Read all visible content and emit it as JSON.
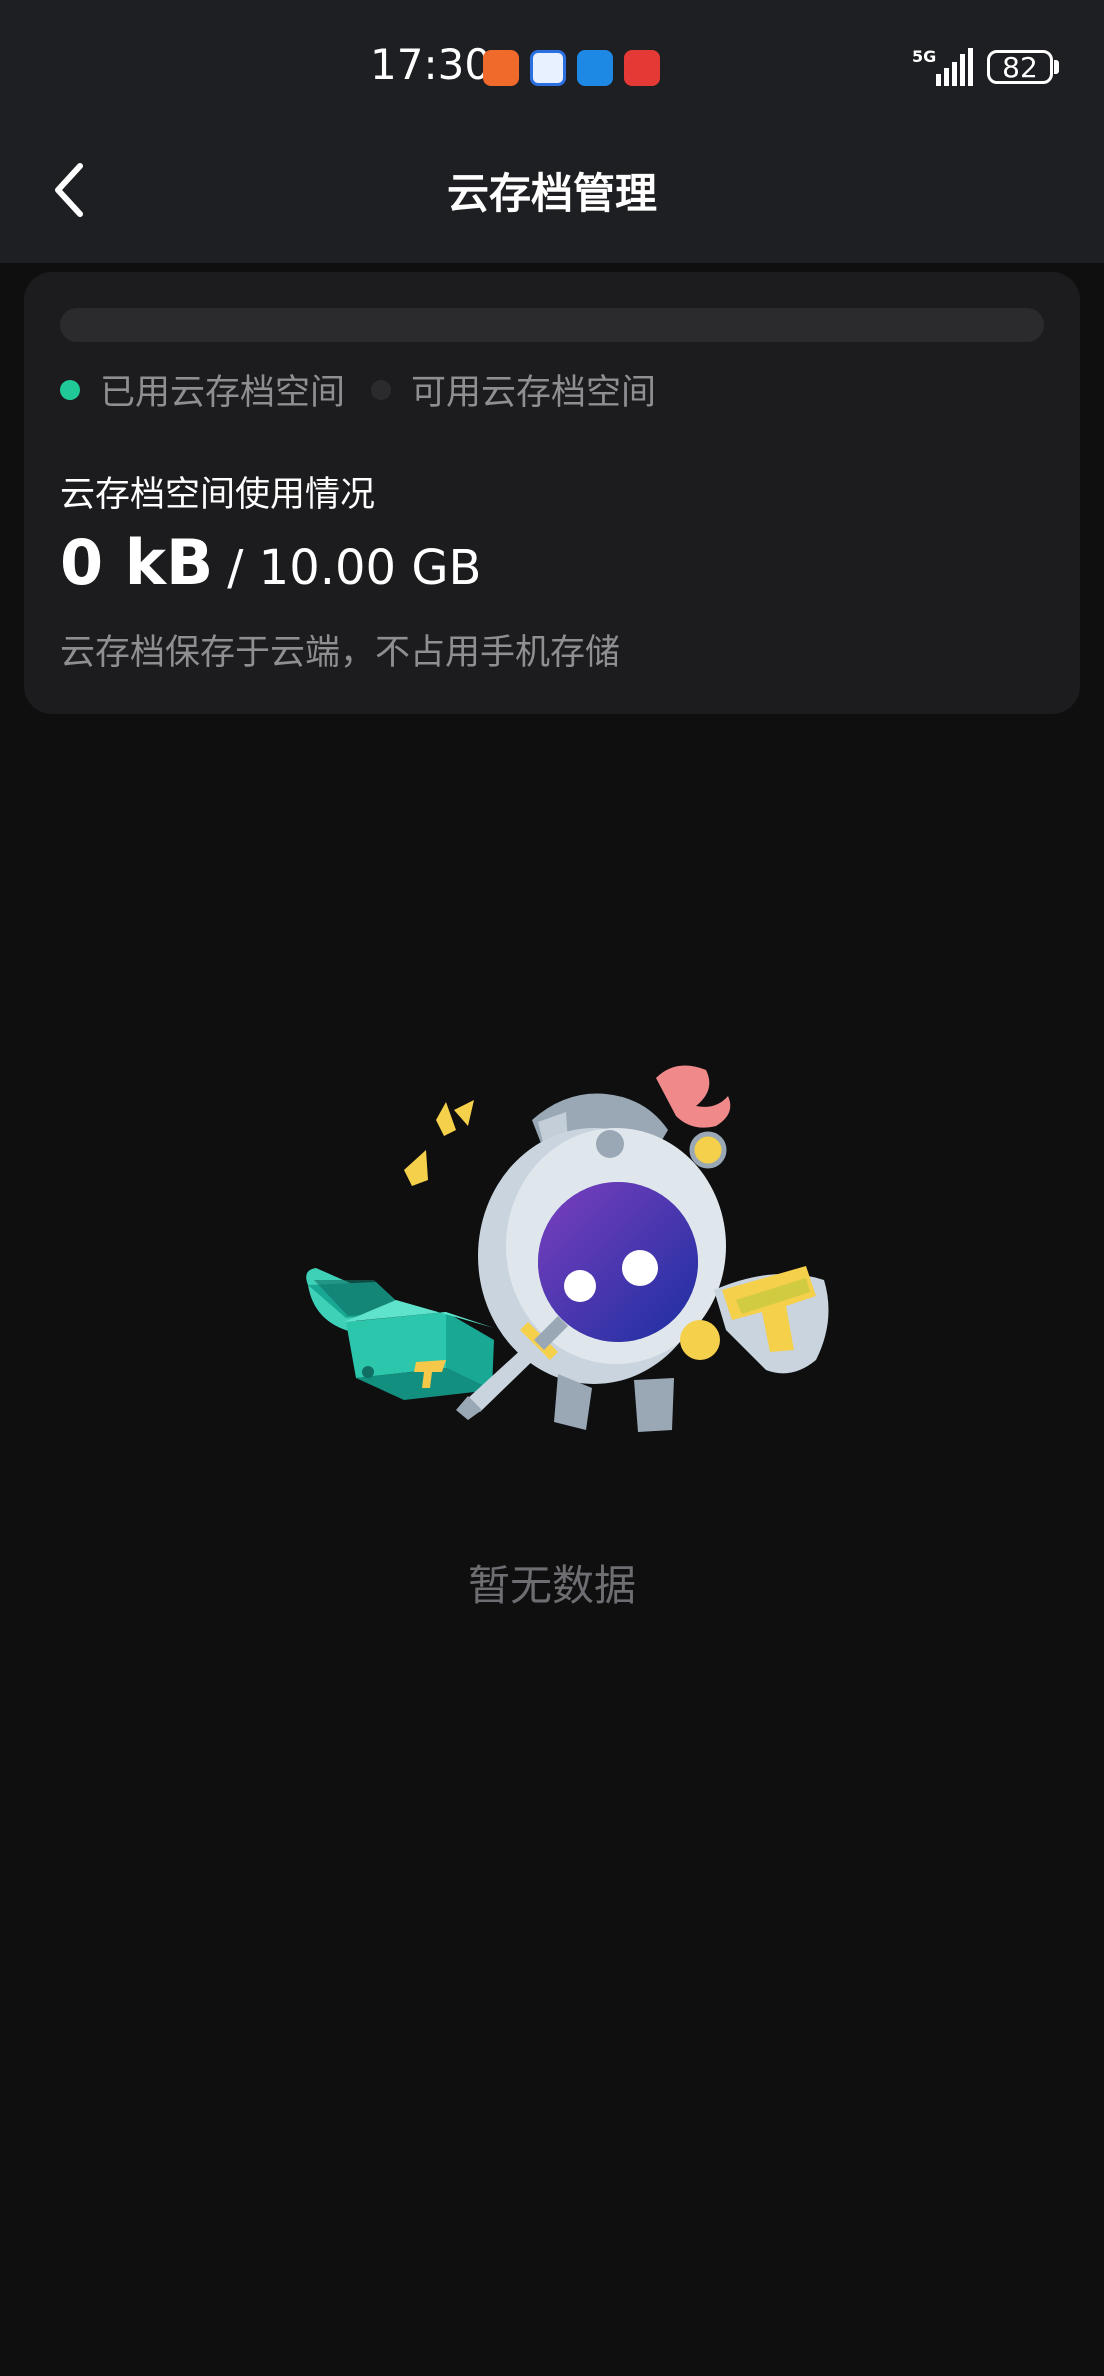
{
  "status_bar": {
    "time": "17:30",
    "network": "5G",
    "battery": "82",
    "app_icons": [
      "orange-app-icon",
      "blue-tool-app-icon",
      "weather-app-icon",
      "red-app-icon"
    ]
  },
  "header": {
    "title": "云存档管理",
    "back_icon": "chevron-left-icon"
  },
  "storage": {
    "used_fraction": 0,
    "legend_used": "已用云存档空间",
    "legend_available": "可用云存档空间",
    "section_label": "云存档空间使用情况",
    "used_value": "0 kB",
    "total_value": "/ 10.00 GB",
    "note": "云存档保存于云端，不占用手机存储",
    "colors": {
      "used": "#20c997",
      "available": "#2b2b2d"
    }
  },
  "empty_state": {
    "illustration": "knight-mascot-with-treasure-chest",
    "message": "暂无数据"
  }
}
